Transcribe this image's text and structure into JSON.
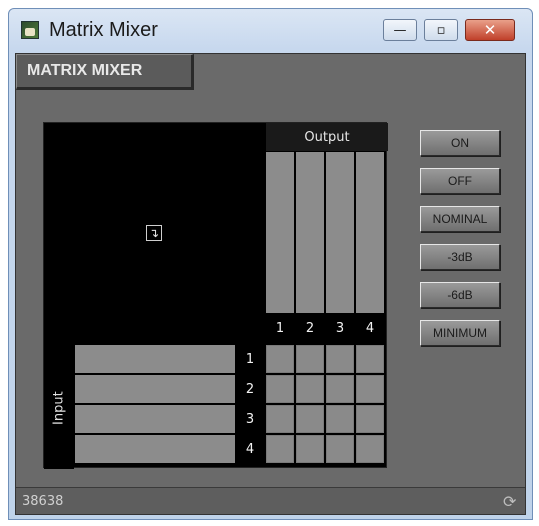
{
  "window": {
    "title": "Matrix Mixer",
    "icon": "app-icon"
  },
  "titlebar_controls": {
    "minimize": "—",
    "maximize": "▫",
    "close": "✕"
  },
  "panel": {
    "tab_label": "MATRIX MIXER"
  },
  "matrix": {
    "output_label": "Output",
    "input_label": "Input",
    "outputs": [
      "1",
      "2",
      "3",
      "4"
    ],
    "inputs": [
      "1",
      "2",
      "3",
      "4"
    ],
    "corner_icon": "corner-arrow-icon"
  },
  "buttons": [
    {
      "label": "ON"
    },
    {
      "label": "OFF"
    },
    {
      "label": "NOMINAL"
    },
    {
      "label": "-3dB"
    },
    {
      "label": "-6dB"
    },
    {
      "label": "MINIMUM"
    }
  ],
  "footer": {
    "id": "38638",
    "refresh_icon": "refresh-icon"
  }
}
